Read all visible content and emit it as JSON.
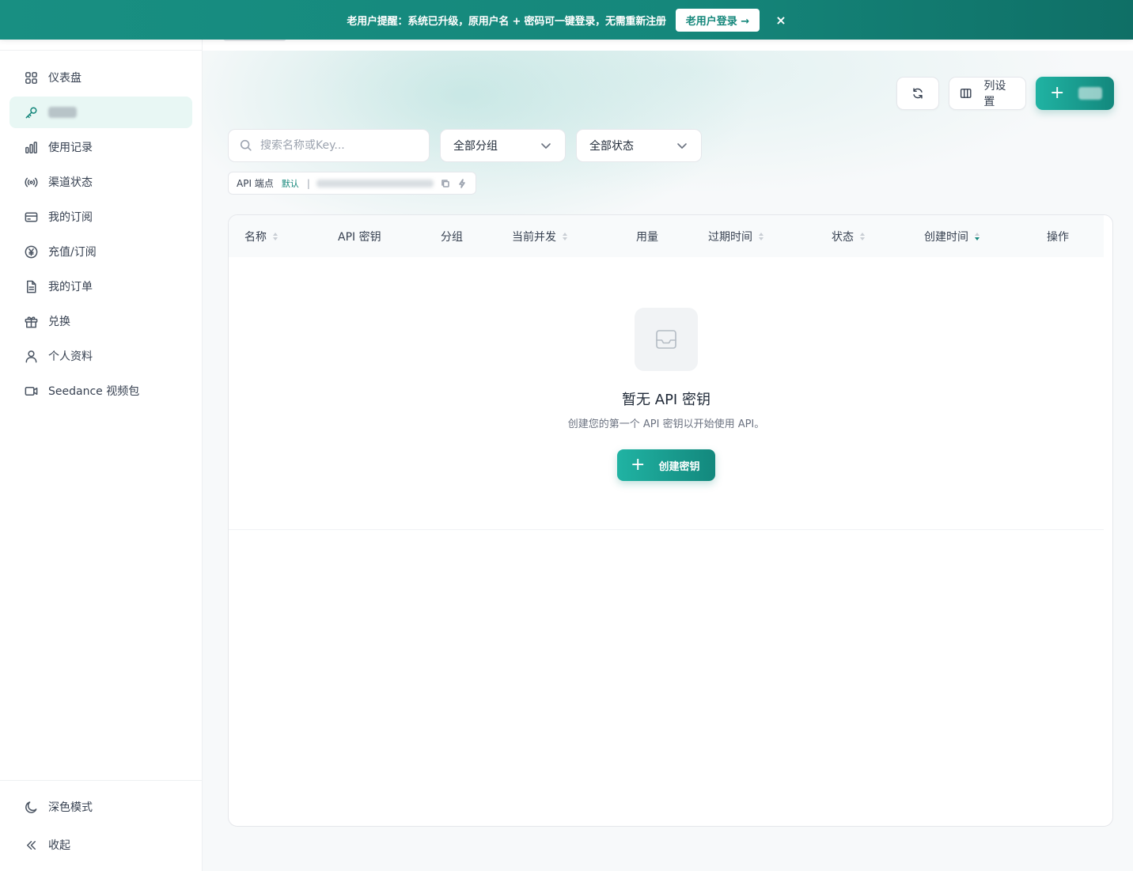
{
  "banner": {
    "text": "老用户提醒：系统已升级，原用户名 + 密码可一键登录，无需重新注册",
    "login_label": "老用户登录 →",
    "close_label": "×"
  },
  "sidebar": {
    "items": [
      {
        "label": "仪表盘",
        "icon": "dashboard-icon"
      },
      {
        "label": "",
        "icon": "key-icon",
        "active": true
      },
      {
        "label": "使用记录",
        "icon": "bar-chart-icon"
      },
      {
        "label": "渠道状态",
        "icon": "broadcast-icon"
      },
      {
        "label": "我的订阅",
        "icon": "credit-card-icon"
      },
      {
        "label": "充值/订阅",
        "icon": "yen-icon"
      },
      {
        "label": "我的订单",
        "icon": "document-icon"
      },
      {
        "label": "兑换",
        "icon": "gift-icon"
      },
      {
        "label": "个人资料",
        "icon": "user-icon"
      },
      {
        "label": "Seedance 视频包",
        "icon": "video-icon"
      }
    ],
    "bottom": {
      "dark_mode": "深色模式",
      "collapse": "收起"
    }
  },
  "toolbar": {
    "columns_label": "列设置"
  },
  "filters": {
    "search_placeholder": "搜索名称或Key...",
    "group_value": "全部分组",
    "status_value": "全部状态"
  },
  "endpoint": {
    "label": "API 端点",
    "default_badge": "默认",
    "separator": "|"
  },
  "table": {
    "columns": [
      "名称",
      "API 密钥",
      "分组",
      "当前并发",
      "用量",
      "过期时间",
      "状态",
      "创建时间",
      "操作"
    ]
  },
  "empty": {
    "title": "暂无 API 密钥",
    "description": "创建您的第一个 API 密钥以开始使用 API。",
    "create_label": "创建密钥"
  },
  "colors": {
    "accent": "#15877b",
    "accent_light": "#20b3a3",
    "active_bg": "#e8f7f4"
  }
}
